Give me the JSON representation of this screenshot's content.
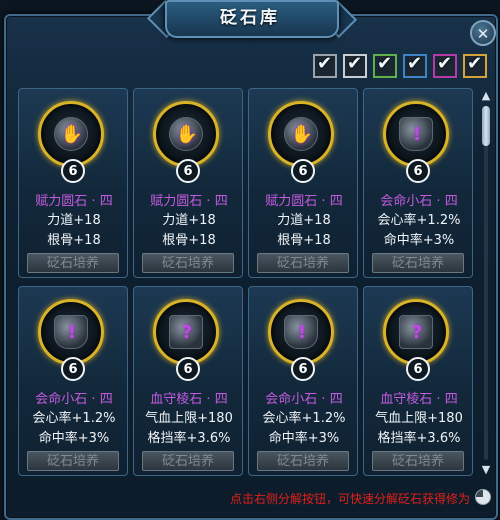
{
  "window": {
    "title": "砭石库",
    "close_glyph": "✕"
  },
  "filters": [
    {
      "id": "all",
      "checked": true,
      "color": "#9aa3ab"
    },
    {
      "id": "white",
      "checked": true,
      "color": "#c9ced3"
    },
    {
      "id": "green",
      "checked": true,
      "color": "#5fb04a"
    },
    {
      "id": "blue",
      "checked": true,
      "color": "#3d83c6"
    },
    {
      "id": "purple",
      "checked": true,
      "color": "#b53aa8"
    },
    {
      "id": "orange",
      "checked": true,
      "color": "#d6a23a"
    }
  ],
  "check_glyph": "✔",
  "cards": [
    {
      "icon": "hand-gem-icon",
      "glyph": "✋",
      "level": "6",
      "name": "赋力圆石 · 四",
      "stat1": "力道+18",
      "stat2": "根骨+18",
      "button": "砭石培养"
    },
    {
      "icon": "hand-gem-icon",
      "glyph": "✋",
      "level": "6",
      "name": "赋力圆石 · 四",
      "stat1": "力道+18",
      "stat2": "根骨+18",
      "button": "砭石培养"
    },
    {
      "icon": "hand-gem-icon",
      "glyph": "✋",
      "level": "6",
      "name": "赋力圆石 · 四",
      "stat1": "力道+18",
      "stat2": "根骨+18",
      "button": "砭石培养"
    },
    {
      "icon": "shield-gem-icon",
      "glyph": "!",
      "level": "6",
      "name": "会命小石 · 四",
      "stat1": "会心率+1.2%",
      "stat2": "命中率+3%",
      "button": "砭石培养"
    },
    {
      "icon": "shield-gem-icon",
      "glyph": "!",
      "level": "6",
      "name": "会命小石 · 四",
      "stat1": "会心率+1.2%",
      "stat2": "命中率+3%",
      "button": "砭石培养"
    },
    {
      "icon": "square-gem-icon",
      "glyph": "?",
      "level": "6",
      "name": "血守棱石 · 四",
      "stat1": "气血上限+180",
      "stat2": "格挡率+3.6%",
      "button": "砭石培养"
    },
    {
      "icon": "shield-gem-icon",
      "glyph": "!",
      "level": "6",
      "name": "会命小石 · 四",
      "stat1": "会心率+1.2%",
      "stat2": "命中率+3%",
      "button": "砭石培养"
    },
    {
      "icon": "square-gem-icon",
      "glyph": "?",
      "level": "6",
      "name": "血守棱石 · 四",
      "stat1": "气血上限+180",
      "stat2": "格挡率+3.6%",
      "button": "砭石培养"
    }
  ],
  "scroll": {
    "up_glyph": "▲",
    "down_glyph": "▼"
  },
  "hint": "点击右侧分解按钮，可快速分解砭石获得修为",
  "colors": {
    "gem_name": "#c35ae0",
    "hint": "#e0201a",
    "gem_ring": "#d8b328"
  }
}
